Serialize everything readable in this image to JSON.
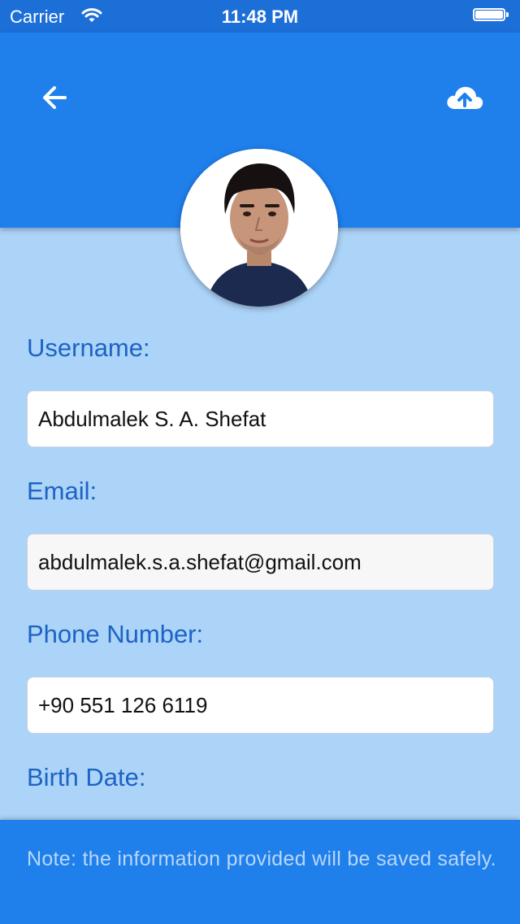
{
  "status_bar": {
    "carrier": "Carrier",
    "time": "11:48 PM"
  },
  "header": {
    "back_icon": "arrow-left-icon",
    "upload_icon": "cloud-upload-icon",
    "color": "#1f80ec"
  },
  "profile": {
    "avatar": "profile-photo"
  },
  "form": {
    "username": {
      "label": "Username:",
      "value": "Abdulmalek S. A. Shefat"
    },
    "email": {
      "label": "Email:",
      "value": "abdulmalek.s.a.shefat@gmail.com"
    },
    "phone": {
      "label": "Phone Number:",
      "value": "+90 551 126 6119"
    },
    "birth_date": {
      "label": "Birth Date:"
    }
  },
  "footer": {
    "note": "Note: the information provided will be saved safely."
  },
  "colors": {
    "background": "#acd3f8",
    "primary": "#1f80ec",
    "label": "#1c63c4"
  }
}
